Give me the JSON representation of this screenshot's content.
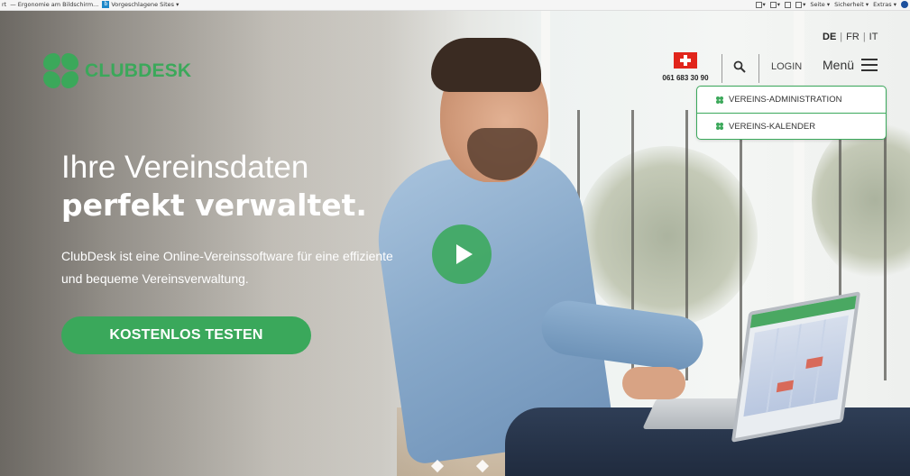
{
  "browser": {
    "left_items": [
      {
        "label": "rt"
      },
      {
        "label": "Ergonomie am Bildschirm..."
      },
      {
        "label": "Vorgeschlagene Sites ▾"
      }
    ],
    "right_items": [
      "▾",
      "▾",
      "▾",
      "Seite ▾",
      "Sicherheit ▾",
      "Extras ▾"
    ]
  },
  "header": {
    "logo_text": "CLUBDESK",
    "languages": [
      "DE",
      "FR",
      "IT"
    ],
    "active_language": "DE",
    "phone": "061 683 30 90",
    "login_label": "LOGIN",
    "menu_label": "Menü"
  },
  "dropdown": {
    "items": [
      "VEREINS-ADMINISTRATION",
      "VEREINS-KALENDER"
    ]
  },
  "hero": {
    "headline_line1": "Ihre Vereinsdaten",
    "headline_line2": "perfekt verwaltet.",
    "subtext": "ClubDesk ist eine Online-Vereinssoftware für eine effiziente und bequeme Vereinsverwaltung.",
    "cta_label": "KOSTENLOS TESTEN"
  },
  "colors": {
    "brand_green": "#3aa85b",
    "swiss_red": "#e1251b"
  }
}
